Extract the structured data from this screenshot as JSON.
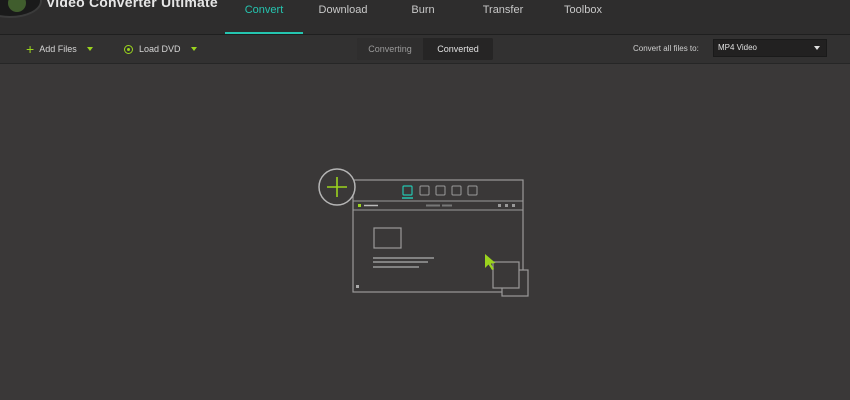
{
  "app": {
    "title": "Video Converter Ultimate"
  },
  "nav": {
    "tabs": [
      {
        "label": "Convert",
        "active": true
      },
      {
        "label": "Download",
        "active": false
      },
      {
        "label": "Burn",
        "active": false
      },
      {
        "label": "Transfer",
        "active": false
      },
      {
        "label": "Toolbox",
        "active": false
      }
    ]
  },
  "toolbar": {
    "add_files_label": "Add Files",
    "load_dvd_label": "Load DVD",
    "segments": [
      {
        "label": "Converting",
        "selected": false
      },
      {
        "label": "Converted",
        "selected": true
      }
    ],
    "convert_all_label": "Convert all files to:",
    "format_value": "MP4 Video"
  },
  "colors": {
    "accent_teal": "#25c5b0",
    "accent_green": "#9bd41e",
    "background": "#3a3838"
  },
  "icons": [
    "logo-icon",
    "plus-icon",
    "dvd-icon",
    "caret-down-icon",
    "add-file-illustration-icon"
  ]
}
